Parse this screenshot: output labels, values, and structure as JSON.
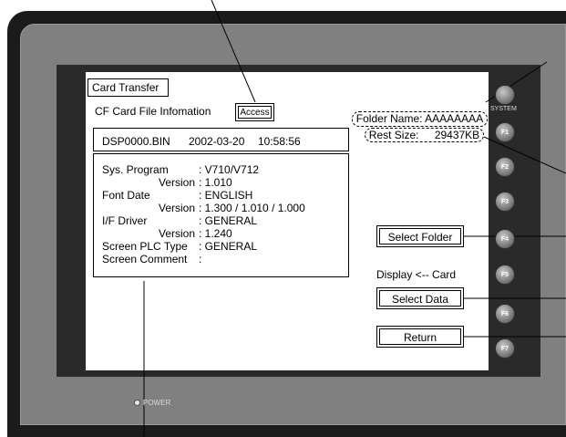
{
  "window": {
    "title": "Card Transfer"
  },
  "info": {
    "header": "CF Card File Infomation",
    "access_label": "Access",
    "file_name": "DSP0000.BIN",
    "file_date": "2002-03-20",
    "file_time": "10:58:56",
    "rows": [
      {
        "label": "Sys. Program",
        "value": ": V710/V712"
      },
      {
        "label": "Version",
        "value": ": 1.010"
      },
      {
        "label": "Font Date",
        "value": ": ENGLISH"
      },
      {
        "label": "Version",
        "value": ": 1.300 / 1.010 / 1.000"
      },
      {
        "label": "I/F Driver",
        "value": ": GENERAL"
      },
      {
        "label": "Version",
        "value": ": 1.240"
      },
      {
        "label": "Screen PLC Type",
        "value": ": GENERAL"
      },
      {
        "label": "Screen Comment",
        "value": ":"
      }
    ]
  },
  "folder": {
    "name_label": "Folder Name: AAAAAAAA",
    "rest_label": "Rest Size:",
    "rest_value": "29437KB"
  },
  "buttons": {
    "select_folder": "Select Folder",
    "select_data": "Select Data",
    "return": "Return"
  },
  "direction": {
    "label": "Display",
    "arrow": "<--",
    "target": "Card"
  },
  "hardware": {
    "system_label": "SYSTEM",
    "fkeys": [
      "F1",
      "F2",
      "F3",
      "F4",
      "F5",
      "F6",
      "F7"
    ],
    "power_label": "POWER"
  }
}
